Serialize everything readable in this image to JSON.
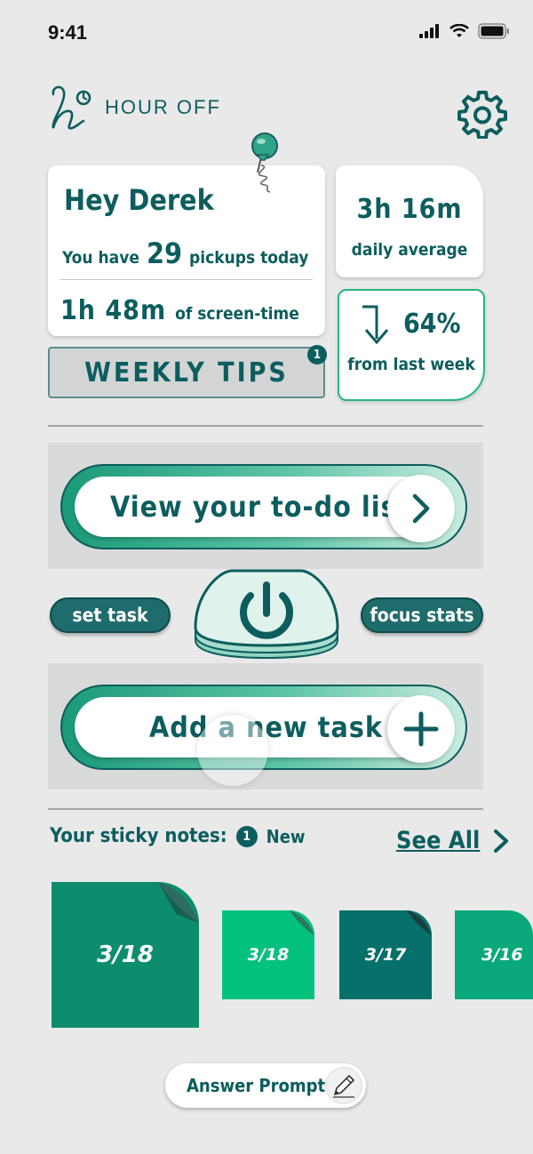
{
  "status_bar": {
    "time": "9:41"
  },
  "app": {
    "name": "HOUR OFF"
  },
  "greeting": {
    "title": "Hey Derek",
    "pickups_prefix": "You have",
    "pickups_count": "29",
    "pickups_suffix": "pickups today",
    "screen_time": "1h 48m",
    "screen_time_suffix": "of screen-time"
  },
  "daily_average": {
    "value": "3h 16m",
    "label": "daily average"
  },
  "change": {
    "value": "64%",
    "label": "from last week"
  },
  "weekly_tips": {
    "label": "WEEKLY TIPS",
    "badge": "1"
  },
  "todo": {
    "label": "View your to-do list"
  },
  "set_task": {
    "label": "set task"
  },
  "focus_stats": {
    "label": "focus stats"
  },
  "add_task": {
    "label": "Add a new task"
  },
  "sticky_notes": {
    "title": "Your sticky notes:",
    "new_count": "1",
    "new_label": "New",
    "see_all": "See All",
    "notes": [
      {
        "date": "3/18",
        "color": "#0e8c6e"
      },
      {
        "date": "3/18",
        "color": "#05c17e"
      },
      {
        "date": "3/17",
        "color": "#08706b"
      },
      {
        "date": "3/16",
        "color": "#0aa87b"
      }
    ]
  },
  "answer_prompt": {
    "label": "Answer Prompt"
  },
  "colors": {
    "primary": "#0d5d5e",
    "accent": "#26b780",
    "background": "#e9e9ea"
  }
}
